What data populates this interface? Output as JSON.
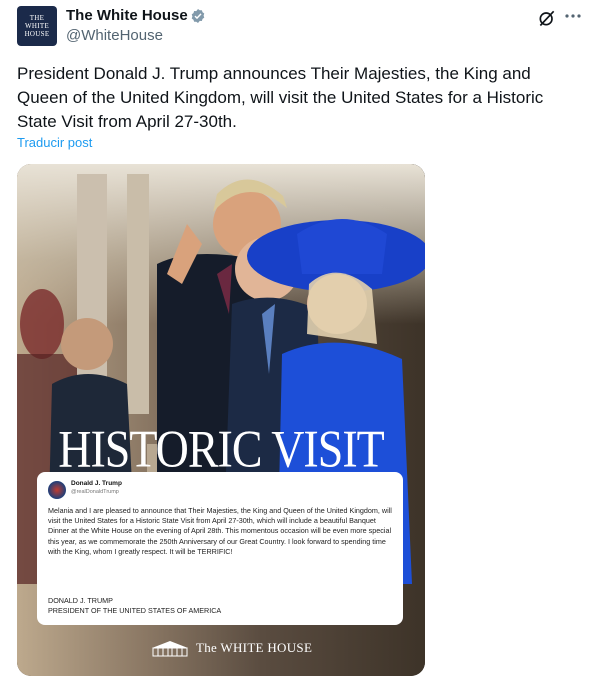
{
  "account": {
    "display_name": "The White House",
    "handle": "@WhiteHouse",
    "avatar_line1": "THE",
    "avatar_line2": "WHITE",
    "avatar_line3": "HOUSE"
  },
  "tweet": {
    "text": "President Donald J. Trump announces Their Majesties, the King and Queen of the United Kingdom, will visit the United States for a Historic State Visit from April 27-30th.",
    "translate_label": "Traducir post"
  },
  "media": {
    "headline": "HISTORIC VISIT",
    "card": {
      "name": "Donald J. Trump",
      "handle": "@realDonaldTrump",
      "body": "Melania and I are pleased to announce that Their Majesties, the King and Queen of the United Kingdom, will visit the United States for a Historic State Visit from April 27-30th, which will include a beautiful Banquet Dinner at the White House on the evening of April 28th. This momentous occasion will be even more special this year, as we commemorate the 250th Anniversary of our Great Country. I look forward to spending time with the King, whom I greatly respect. It will be TERRIFIC!",
      "sign_line1": "DONALD J. TRUMP",
      "sign_line2": "PRESIDENT OF THE UNITED STATES OF AMERICA"
    },
    "footer_logo_text": "The WHITE HOUSE"
  },
  "icons": {
    "verified": "verified-badge-icon",
    "grok": "grok-icon",
    "more": "more-icon"
  },
  "colors": {
    "link": "#1d9bf0",
    "secondary_text": "#536471",
    "verified": "#829aab"
  }
}
